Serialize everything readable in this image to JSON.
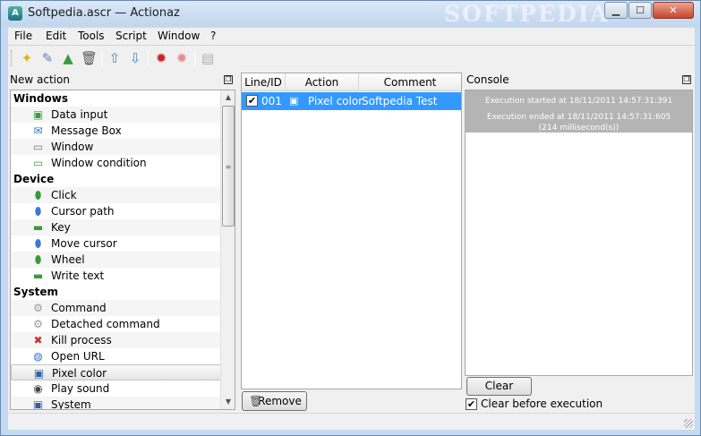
{
  "window": {
    "title": "Softpedia.ascr — Actionaz",
    "watermark": "SOFTPEDIA",
    "controls": {
      "minimize": "▁",
      "maximize": "☐",
      "close": "✕"
    }
  },
  "menu": [
    "File",
    "Edit",
    "Tools",
    "Script",
    "Window",
    "?"
  ],
  "toolbar": {
    "icons": [
      "new-action-icon",
      "edit-icon",
      "shapes-icon",
      "trash-icon",
      "move-up-icon",
      "move-down-icon",
      "run-icon",
      "run-selection-icon",
      "notes-icon"
    ]
  },
  "new_action_panel": {
    "title": "New action",
    "float_glyph": "❐",
    "categories": [
      {
        "name": "Windows",
        "items": [
          {
            "label": "Data input",
            "icon": "data-input-icon"
          },
          {
            "label": "Message Box",
            "icon": "message-box-icon"
          },
          {
            "label": "Window",
            "icon": "window-icon"
          },
          {
            "label": "Window condition",
            "icon": "window-condition-icon"
          }
        ]
      },
      {
        "name": "Device",
        "items": [
          {
            "label": "Click",
            "icon": "mouse-icon"
          },
          {
            "label": "Cursor path",
            "icon": "cursor-path-icon"
          },
          {
            "label": "Key",
            "icon": "key-icon"
          },
          {
            "label": "Move cursor",
            "icon": "move-cursor-icon"
          },
          {
            "label": "Wheel",
            "icon": "wheel-icon"
          },
          {
            "label": "Write text",
            "icon": "write-text-icon"
          }
        ]
      },
      {
        "name": "System",
        "items": [
          {
            "label": "Command",
            "icon": "command-icon"
          },
          {
            "label": "Detached command",
            "icon": "detached-command-icon"
          },
          {
            "label": "Kill process",
            "icon": "kill-process-icon"
          },
          {
            "label": "Open URL",
            "icon": "globe-icon"
          },
          {
            "label": "Pixel color",
            "icon": "pixel-color-icon",
            "selected": true
          },
          {
            "label": "Play sound",
            "icon": "speaker-icon"
          },
          {
            "label": "System",
            "icon": "system-icon"
          }
        ]
      }
    ]
  },
  "script_table": {
    "columns": [
      "Line/ID",
      "Action",
      "Comment"
    ],
    "rows": [
      {
        "checked": true,
        "line": "001",
        "action": "Pixel color",
        "comment": "Softpedia Test"
      }
    ],
    "remove_label": "Remove"
  },
  "console": {
    "title": "Console",
    "float_glyph": "❐",
    "lines": [
      "Execution started at 18/11/2011 14:57:31:391",
      "Execution ended at 18/11/2011 14:57:31:605",
      "(214 millisecond(s))"
    ],
    "clear_label": "Clear",
    "clear_before_label": "Clear before execution",
    "clear_before_checked": true
  },
  "colors": {
    "selection": "#3399ff",
    "console_log_bg": "#b4b4b4",
    "window_frame": "#c5d9f0"
  }
}
